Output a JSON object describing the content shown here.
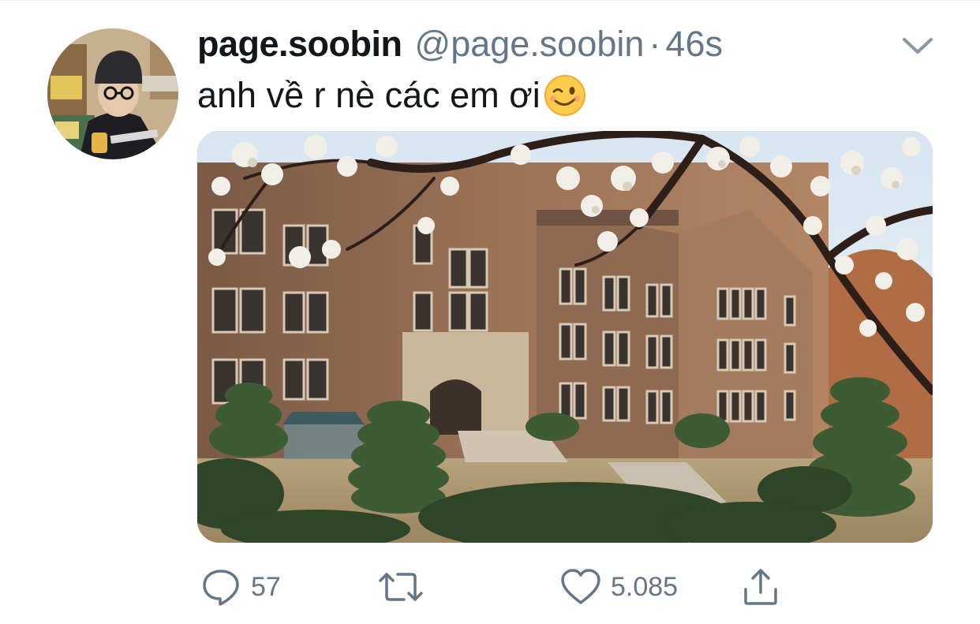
{
  "tweet": {
    "display_name": "page.soobin",
    "handle": "@page.soobin",
    "separator": "·",
    "time": "46s",
    "text": "anh về r nè các em ơi",
    "emoji": "winking-face"
  },
  "actions": {
    "reply_count": "57",
    "retweet_count": "",
    "like_count": "5.085"
  },
  "colors": {
    "text_primary": "#14171a",
    "text_secondary": "#657786",
    "icon": "#657786"
  }
}
